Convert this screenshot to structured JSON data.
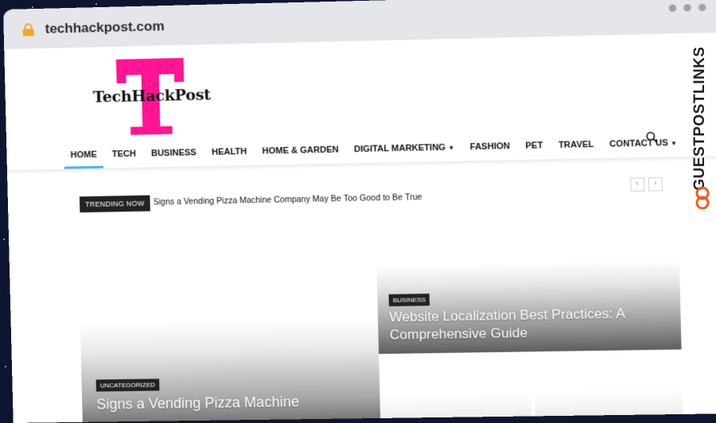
{
  "browser": {
    "url": "techhackpost.com",
    "lock_icon": "lock-icon",
    "lock_color": "#f5a623"
  },
  "site": {
    "logo_text": "TechHackPost",
    "logo_color": "#ff1493"
  },
  "nav": {
    "items": [
      {
        "label": "HOME",
        "active": true
      },
      {
        "label": "TECH"
      },
      {
        "label": "BUSINESS"
      },
      {
        "label": "HEALTH"
      },
      {
        "label": "HOME & GARDEN"
      },
      {
        "label": "DIGITAL MARKETING",
        "dropdown": true
      },
      {
        "label": "FASHION"
      },
      {
        "label": "PET"
      },
      {
        "label": "TRAVEL"
      },
      {
        "label": "CONTACT US",
        "dropdown": true
      }
    ],
    "search_icon": "search-icon",
    "accent": "#4db2ec"
  },
  "trending": {
    "badge": "TRENDING NOW",
    "headline": "Signs a Vending Pizza Machine Company May Be Too Good to Be True",
    "prev_icon": "‹",
    "next_icon": "›"
  },
  "features": {
    "left": {
      "category": "UNCATEGORIZED",
      "title": "Signs a Vending Pizza Machine"
    },
    "right": {
      "category": "BUSINESS",
      "title": "Website Localization Best Practices: A Comprehensive Guide"
    }
  },
  "watermark": {
    "text": "GUESTPOSTLINKS",
    "logo_color": "#f15a24"
  }
}
